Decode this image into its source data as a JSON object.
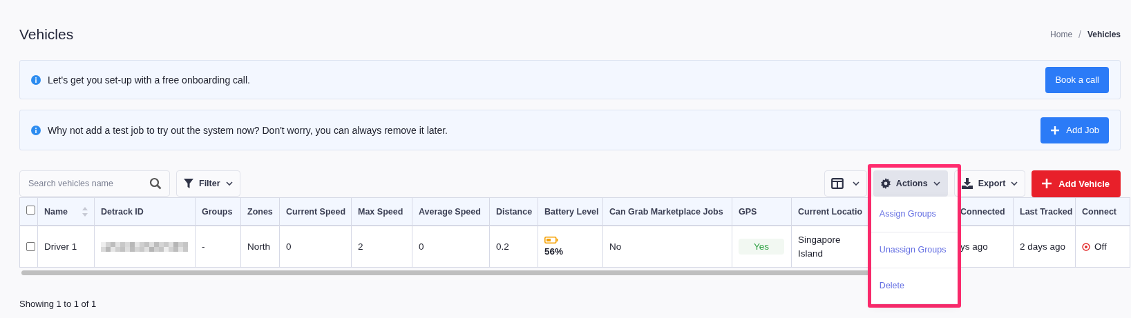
{
  "page": {
    "title": "Vehicles"
  },
  "breadcrumb": {
    "separator": "/",
    "items": [
      {
        "label": "Home",
        "current": false
      },
      {
        "label": "Vehicles",
        "current": true
      }
    ]
  },
  "banners": [
    {
      "text": "Let's get you set-up with a free onboarding call.",
      "button": {
        "kind": "plain",
        "label": "Book a call"
      }
    },
    {
      "text": "Why not add a test job to try out the system now? Don't worry, you can always remove it later.",
      "button": {
        "kind": "add",
        "label": "Add Job"
      }
    }
  ],
  "toolbar": {
    "search": {
      "placeholder": "Search vehicles name"
    },
    "filter": {
      "label": "Filter"
    },
    "actions": {
      "label": "Actions",
      "open": true,
      "highlighted": true
    },
    "export": {
      "label": "Export"
    },
    "add_vehicle": {
      "label": "Add Vehicle"
    }
  },
  "actions_menu": {
    "items": [
      "Assign Groups",
      "Unassign Groups",
      "Delete"
    ]
  },
  "table": {
    "columns": [
      {
        "kind": "checkbox",
        "checked": false
      },
      {
        "label": "Name",
        "sortable": true
      },
      {
        "label": "Detrack ID",
        "sortable": false
      },
      {
        "label": "Groups",
        "sortable": false
      },
      {
        "label": "Zones",
        "sortable": false
      },
      {
        "label": "Current Speed",
        "sortable": false
      },
      {
        "label": "Max Speed",
        "sortable": false
      },
      {
        "label": "Average Speed",
        "sortable": false
      },
      {
        "label": "Distance",
        "sortable": false
      },
      {
        "label": "Battery Level",
        "sortable": false
      },
      {
        "label": "Can Grab Marketplace Jobs",
        "sortable": false
      },
      {
        "label": "GPS",
        "sortable": false
      },
      {
        "label": "Current Locatio",
        "sortable": false
      },
      {
        "label": "Connected",
        "sortable": false
      },
      {
        "label": "Last Tracked",
        "sortable": false
      },
      {
        "label": "Connect",
        "sortable": false
      }
    ],
    "rows": [
      {
        "cells": [
          {
            "kind": "checkbox",
            "checked": false
          },
          {
            "kind": "text",
            "text": "Driver 1"
          },
          {
            "kind": "redacted"
          },
          {
            "kind": "text",
            "text": "-"
          },
          {
            "kind": "text",
            "text": "North"
          },
          {
            "kind": "text",
            "text": "0"
          },
          {
            "kind": "text",
            "text": "2"
          },
          {
            "kind": "text",
            "text": "0"
          },
          {
            "kind": "text",
            "text": "0.2"
          },
          {
            "kind": "battery",
            "text": "56%"
          },
          {
            "kind": "text",
            "text": "No"
          },
          {
            "kind": "badge",
            "text": "Yes"
          },
          {
            "kind": "location",
            "text": "Singapore Island"
          },
          {
            "kind": "text",
            "text": "ys ago"
          },
          {
            "kind": "text",
            "text": "2 days ago"
          },
          {
            "kind": "status",
            "text": "Off"
          }
        ]
      }
    ]
  },
  "footer": {
    "text": "Showing 1 to 1 of 1"
  }
}
